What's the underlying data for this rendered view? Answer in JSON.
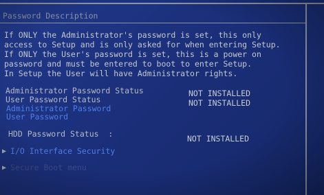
{
  "section_title": "Password Description",
  "description_lines": [
    "If ONLY the Administrator's password is set, this only",
    "access to Setup and is only asked for when entering Setup.",
    "If ONLY the User's password is set, this is a power on",
    "password and must be entered to boot to enter Setup.",
    "In Setup the User will have Administrator rights."
  ],
  "status_items": [
    {
      "label": "Administrator Password Status",
      "value": "NOT INSTALLED"
    },
    {
      "label": "User Password Status",
      "value": "NOT INSTALLED"
    }
  ],
  "password_links": [
    {
      "label": "Administrator Password"
    },
    {
      "label": "User Password"
    }
  ],
  "hdd_status": {
    "label": "HDD Password Status  :",
    "value": "NOT INSTALLED"
  },
  "submenus": [
    {
      "label": "I/O Interface Security",
      "arrow": "▶"
    },
    {
      "label": "Secure Boot menu",
      "arrow": "▶"
    }
  ]
}
